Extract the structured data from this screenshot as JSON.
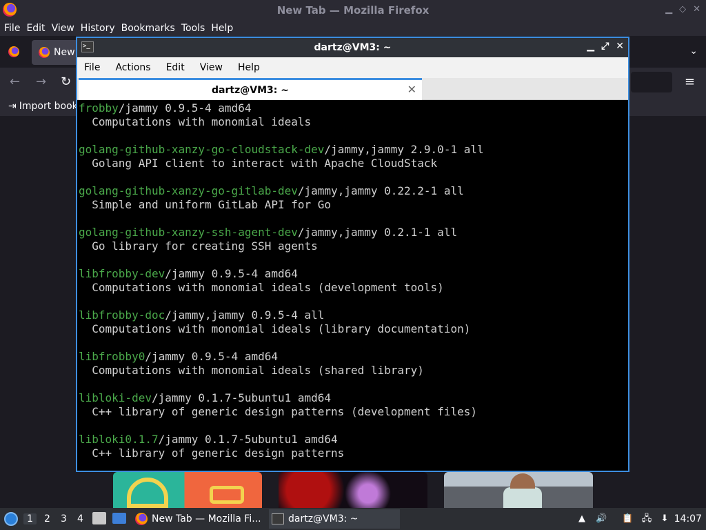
{
  "firefox": {
    "window_title": "New Tab — Mozilla Firefox",
    "menu": [
      "File",
      "Edit",
      "View",
      "History",
      "Bookmarks",
      "Tools",
      "Help"
    ],
    "tab_label": "New",
    "bookmark_label": "Import book"
  },
  "terminal": {
    "window_title": "dartz@VM3: ~",
    "menu": [
      "File",
      "Actions",
      "Edit",
      "View",
      "Help"
    ],
    "tab_label": "dartz@VM3: ~",
    "lines": [
      {
        "pkg": "frobby",
        "rest": "/jammy 0.9.5-4 amd64"
      },
      {
        "pkg": "",
        "rest": "  Computations with monomial ideals"
      },
      {
        "pkg": "",
        "rest": ""
      },
      {
        "pkg": "golang-github-xanzy-go-cloudstack-dev",
        "rest": "/jammy,jammy 2.9.0-1 all"
      },
      {
        "pkg": "",
        "rest": "  Golang API client to interact with Apache CloudStack"
      },
      {
        "pkg": "",
        "rest": ""
      },
      {
        "pkg": "golang-github-xanzy-go-gitlab-dev",
        "rest": "/jammy,jammy 0.22.2-1 all"
      },
      {
        "pkg": "",
        "rest": "  Simple and uniform GitLab API for Go"
      },
      {
        "pkg": "",
        "rest": ""
      },
      {
        "pkg": "golang-github-xanzy-ssh-agent-dev",
        "rest": "/jammy,jammy 0.2.1-1 all"
      },
      {
        "pkg": "",
        "rest": "  Go library for creating SSH agents"
      },
      {
        "pkg": "",
        "rest": ""
      },
      {
        "pkg": "libfrobby-dev",
        "rest": "/jammy 0.9.5-4 amd64"
      },
      {
        "pkg": "",
        "rest": "  Computations with monomial ideals (development tools)"
      },
      {
        "pkg": "",
        "rest": ""
      },
      {
        "pkg": "libfrobby-doc",
        "rest": "/jammy,jammy 0.9.5-4 all"
      },
      {
        "pkg": "",
        "rest": "  Computations with monomial ideals (library documentation)"
      },
      {
        "pkg": "",
        "rest": ""
      },
      {
        "pkg": "libfrobby0",
        "rest": "/jammy 0.9.5-4 amd64"
      },
      {
        "pkg": "",
        "rest": "  Computations with monomial ideals (shared library)"
      },
      {
        "pkg": "",
        "rest": ""
      },
      {
        "pkg": "libloki-dev",
        "rest": "/jammy 0.1.7-5ubuntu1 amd64"
      },
      {
        "pkg": "",
        "rest": "  C++ library of generic design patterns (development files)"
      },
      {
        "pkg": "",
        "rest": ""
      },
      {
        "pkg": "libloki0.1.7",
        "rest": "/jammy 0.1.7-5ubuntu1 amd64"
      },
      {
        "pkg": "",
        "rest": "  C++ library of generic design patterns"
      }
    ]
  },
  "taskbar": {
    "workspaces": [
      "1",
      "2",
      "3",
      "4"
    ],
    "tasks": [
      {
        "label": "New Tab — Mozilla Fi..."
      },
      {
        "label": "dartz@VM3: ~"
      }
    ],
    "clock": "14:07"
  },
  "colors": {
    "terminal_package": "#4aa84a",
    "terminal_text": "#d0d0d0",
    "focus_border": "#3d8ee0"
  }
}
